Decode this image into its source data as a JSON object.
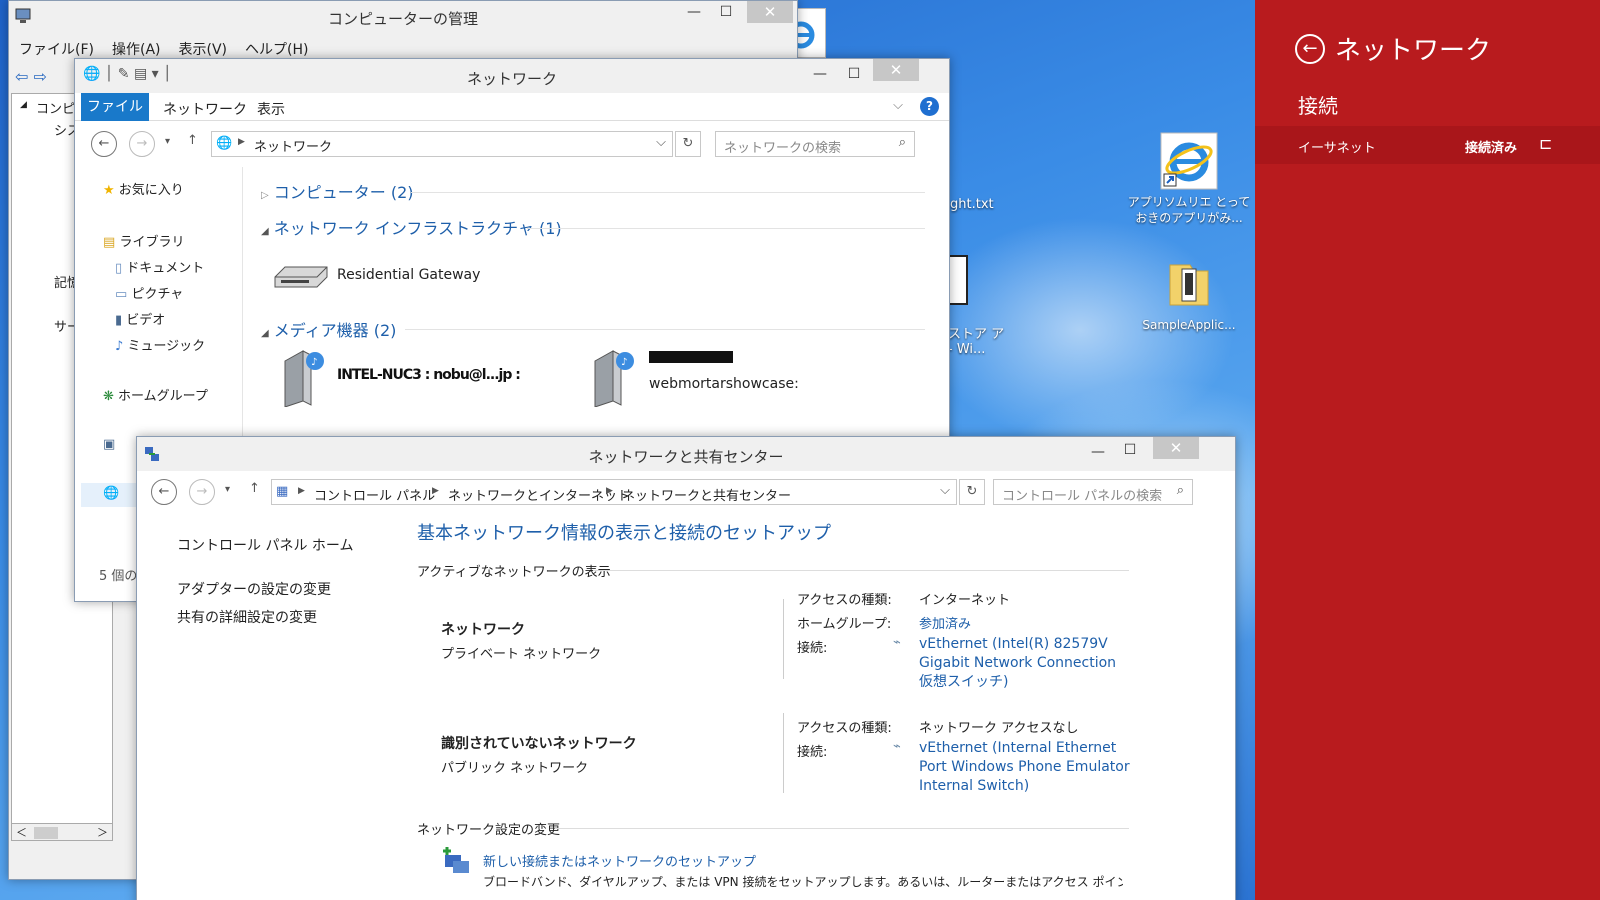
{
  "desktop": {
    "icon_file_partial": "ght.txt",
    "icon_store_partial_1": "ストア ア",
    "icon_store_partial_2": "- Wi...",
    "icon_ie_label": "アプリソムリエ とっておきのアプリがみ...",
    "icon_folder_label": "SampleApplic..."
  },
  "computer_mgmt": {
    "title": "コンピューターの管理",
    "menu": [
      "ファイル(F)",
      "操作(A)",
      "表示(V)",
      "ヘルプ(H)"
    ],
    "tree": [
      "コンピュ",
      "シス",
      "記憶",
      "サー"
    ]
  },
  "explorer": {
    "title": "ネットワーク",
    "ribbon_tabs": [
      "ファイル",
      "ネットワーク",
      "表示"
    ],
    "address": "ネットワーク",
    "search_placeholder": "ネットワークの検索",
    "nav": {
      "favorites": "お気に入り",
      "library": "ライブラリ",
      "documents": "ドキュメント",
      "pictures": "ピクチャ",
      "videos": "ビデオ",
      "music": "ミュージック",
      "homegroup": "ホームグループ"
    },
    "groups": {
      "computers": "コンピューター (2)",
      "infrastructure": "ネットワーク インフラストラクチャ (1)",
      "media": "メディア機器 (2)"
    },
    "gateway_label": "Residential Gateway",
    "media_item_1": "INTEL-NUC3 : nobu@l...jp :",
    "media_item_2": "webmortarshowcase:",
    "status": "5 個の"
  },
  "nsc": {
    "title": "ネットワークと共有センター",
    "breadcrumb": [
      "コントロール パネル",
      "ネットワークとインターネット",
      "ネットワークと共有センター"
    ],
    "search_placeholder": "コントロール パネルの検索",
    "left": {
      "home": "コントロール パネル ホーム",
      "adapter": "アダプターの設定の変更",
      "sharing": "共有の詳細設定の変更"
    },
    "heading": "基本ネットワーク情報の表示と接続のセットアップ",
    "active_section": "アクティブなネットワークの表示",
    "net1": {
      "name": "ネットワーク",
      "type": "プライベート ネットワーク",
      "access_label": "アクセスの種類:",
      "access_value": "インターネット",
      "homegroup_label": "ホームグループ:",
      "homegroup_value": "参加済み",
      "conn_label": "接続:",
      "conn_value": "vEthernet (Intel(R) 82579V Gigabit Network Connection 仮想スイッチ)"
    },
    "net2": {
      "name": "識別されていないネットワーク",
      "type": "パブリック ネットワーク",
      "access_label": "アクセスの種類:",
      "access_value": "ネットワーク アクセスなし",
      "conn_label": "接続:",
      "conn_value": "vEthernet (Internal Ethernet Port Windows Phone Emulator Internal Switch)"
    },
    "change_section": "ネットワーク設定の変更",
    "new_conn": "新しい接続またはネットワークのセットアップ",
    "new_conn_desc": "ブロードバンド、ダイヤルアップ、または VPN 接続をセットアップします。あるいは、ルーターまたはアクセス ポイントを"
  },
  "charm": {
    "title": "ネットワーク",
    "section": "接続",
    "item_name": "イーサネット",
    "item_status": "接続済み"
  },
  "colors": {
    "charm_red": "#b81b1e",
    "link_blue": "#1e5faa",
    "ribbon_blue": "#1979ca"
  }
}
